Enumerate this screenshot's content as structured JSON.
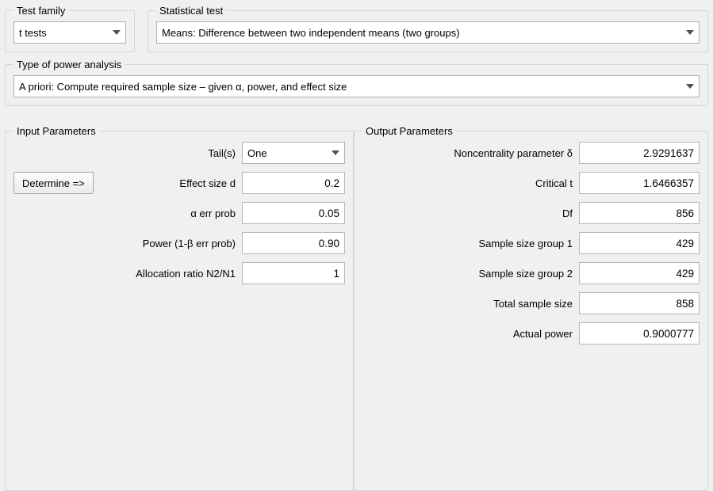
{
  "top": {
    "testFamily": {
      "legend": "Test family",
      "value": "t tests"
    },
    "statisticalTest": {
      "legend": "Statistical test",
      "value": "Means: Difference between two independent means (two groups)"
    }
  },
  "analysisType": {
    "legend": "Type of power analysis",
    "value": "A priori: Compute required sample size – given α, power, and effect size"
  },
  "inputParams": {
    "legend": "Input Parameters",
    "determineLabel": "Determine =>",
    "tails": {
      "label": "Tail(s)",
      "value": "One"
    },
    "effectSize": {
      "label": "Effect size d",
      "value": "0.2"
    },
    "alpha": {
      "label": "α err prob",
      "value": "0.05"
    },
    "power": {
      "label": "Power (1-β err prob)",
      "value": "0.90"
    },
    "allocation": {
      "label": "Allocation ratio N2/N1",
      "value": "1"
    }
  },
  "outputParams": {
    "legend": "Output Parameters",
    "ncp": {
      "label": "Noncentrality parameter δ",
      "value": "2.9291637"
    },
    "critT": {
      "label": "Critical t",
      "value": "1.6466357"
    },
    "df": {
      "label": "Df",
      "value": "856"
    },
    "n1": {
      "label": "Sample size group 1",
      "value": "429"
    },
    "n2": {
      "label": "Sample size group 2",
      "value": "429"
    },
    "total": {
      "label": "Total sample size",
      "value": "858"
    },
    "actualPower": {
      "label": "Actual power",
      "value": "0.9000777"
    }
  }
}
